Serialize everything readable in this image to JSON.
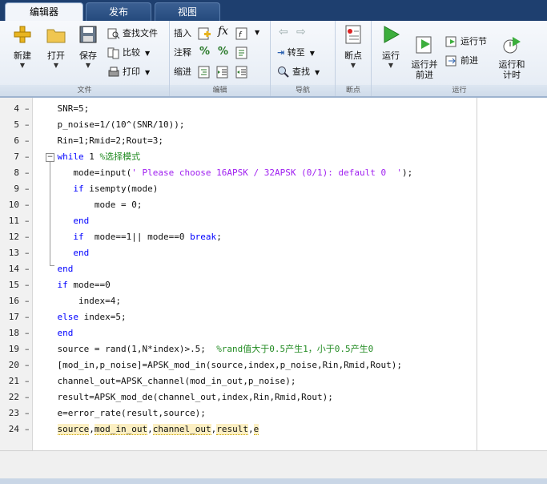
{
  "tabs": [
    {
      "label": "编辑器",
      "active": true
    },
    {
      "label": "发布",
      "active": false
    },
    {
      "label": "视图",
      "active": false
    }
  ],
  "ribbon": {
    "file": {
      "label": "文件",
      "new": "新建",
      "open": "打开",
      "save": "保存",
      "find_files": "查找文件",
      "compare": "比较",
      "print": "打印"
    },
    "edit": {
      "label": "编辑",
      "insert": "插入",
      "comment": "注释",
      "indent": "缩进",
      "fx": "fx"
    },
    "navigate": {
      "label": "导航",
      "goto": "转至",
      "find": "查找"
    },
    "breakpoints": {
      "label": "断点",
      "breakpoints": "断点"
    },
    "run": {
      "label": "运行",
      "run": "运行",
      "run_advance": "运行并\n前进",
      "run_section": "运行节",
      "advance": "前进",
      "run_time": "运行和\n计时"
    }
  },
  "code": {
    "lines": [
      {
        "n": "4",
        "indent": "    ",
        "parts": [
          [
            "SNR=5;",
            ""
          ]
        ]
      },
      {
        "n": "5",
        "indent": "    ",
        "parts": [
          [
            "p_noise=1/(10^(SNR/10));",
            ""
          ]
        ]
      },
      {
        "n": "6",
        "indent": "    ",
        "parts": [
          [
            "Rin=1;Rmid=2;Rout=3;",
            ""
          ]
        ]
      },
      {
        "n": "7",
        "indent": "    ",
        "parts": [
          [
            "while",
            "kw"
          ],
          [
            " 1 ",
            ""
          ],
          [
            "%选择模式",
            "cmt"
          ]
        ]
      },
      {
        "n": "8",
        "indent": "       ",
        "parts": [
          [
            "mode=input(",
            ""
          ],
          [
            "' Please choose 16APSK / 32APSK (0/1): default 0  '",
            "str"
          ],
          [
            ");",
            ""
          ]
        ]
      },
      {
        "n": "9",
        "indent": "       ",
        "parts": [
          [
            "if",
            "kw"
          ],
          [
            " isempty(mode)",
            ""
          ]
        ]
      },
      {
        "n": "10",
        "indent": "           ",
        "parts": [
          [
            "mode = 0;",
            ""
          ]
        ]
      },
      {
        "n": "11",
        "indent": "       ",
        "parts": [
          [
            "end",
            "kw"
          ]
        ]
      },
      {
        "n": "12",
        "indent": "       ",
        "parts": [
          [
            "if",
            "kw"
          ],
          [
            "  mode==1|| mode==0 ",
            ""
          ],
          [
            "break",
            "kw"
          ],
          [
            ";",
            ""
          ]
        ]
      },
      {
        "n": "13",
        "indent": "       ",
        "parts": [
          [
            "end",
            "kw"
          ]
        ]
      },
      {
        "n": "14",
        "indent": "    ",
        "parts": [
          [
            "end",
            "kw"
          ]
        ]
      },
      {
        "n": "15",
        "indent": "    ",
        "parts": [
          [
            "if",
            "kw"
          ],
          [
            " mode==0",
            ""
          ]
        ]
      },
      {
        "n": "16",
        "indent": "        ",
        "parts": [
          [
            "index=4;",
            ""
          ]
        ]
      },
      {
        "n": "17",
        "indent": "    ",
        "parts": [
          [
            "else",
            "kw"
          ],
          [
            " index=5;",
            ""
          ]
        ]
      },
      {
        "n": "18",
        "indent": "    ",
        "parts": [
          [
            "end",
            "kw"
          ]
        ]
      },
      {
        "n": "19",
        "indent": "    ",
        "parts": [
          [
            "source = rand(1,N*index)>.5;  ",
            ""
          ],
          [
            "%rand值大于0.5产生1，小于0.5产生0",
            "cmt"
          ]
        ]
      },
      {
        "n": "20",
        "indent": "    ",
        "parts": [
          [
            "[mod_in,p_noise]=APSK_mod_in(source,index,p_noise,Rin,Rmid,Rout);",
            ""
          ]
        ]
      },
      {
        "n": "21",
        "indent": "    ",
        "parts": [
          [
            "channel_out=APSK_channel(mod_in_out,p_noise);",
            ""
          ]
        ]
      },
      {
        "n": "22",
        "indent": "    ",
        "parts": [
          [
            "result=APSK_mod_de(channel_out,index,Rin,Rmid,Rout);",
            ""
          ]
        ]
      },
      {
        "n": "23",
        "indent": "    ",
        "parts": [
          [
            "e=error_rate(result,source);",
            ""
          ]
        ]
      },
      {
        "n": "24",
        "indent": "    ",
        "parts": [
          [
            "source",
            "hl"
          ],
          [
            ",",
            ""
          ],
          [
            "mod_in_out",
            "hl"
          ],
          [
            ",",
            ""
          ],
          [
            "channel_out",
            "hl"
          ],
          [
            ",",
            ""
          ],
          [
            "result",
            "hl"
          ],
          [
            ",",
            ""
          ],
          [
            "e",
            "hl"
          ]
        ]
      }
    ]
  }
}
